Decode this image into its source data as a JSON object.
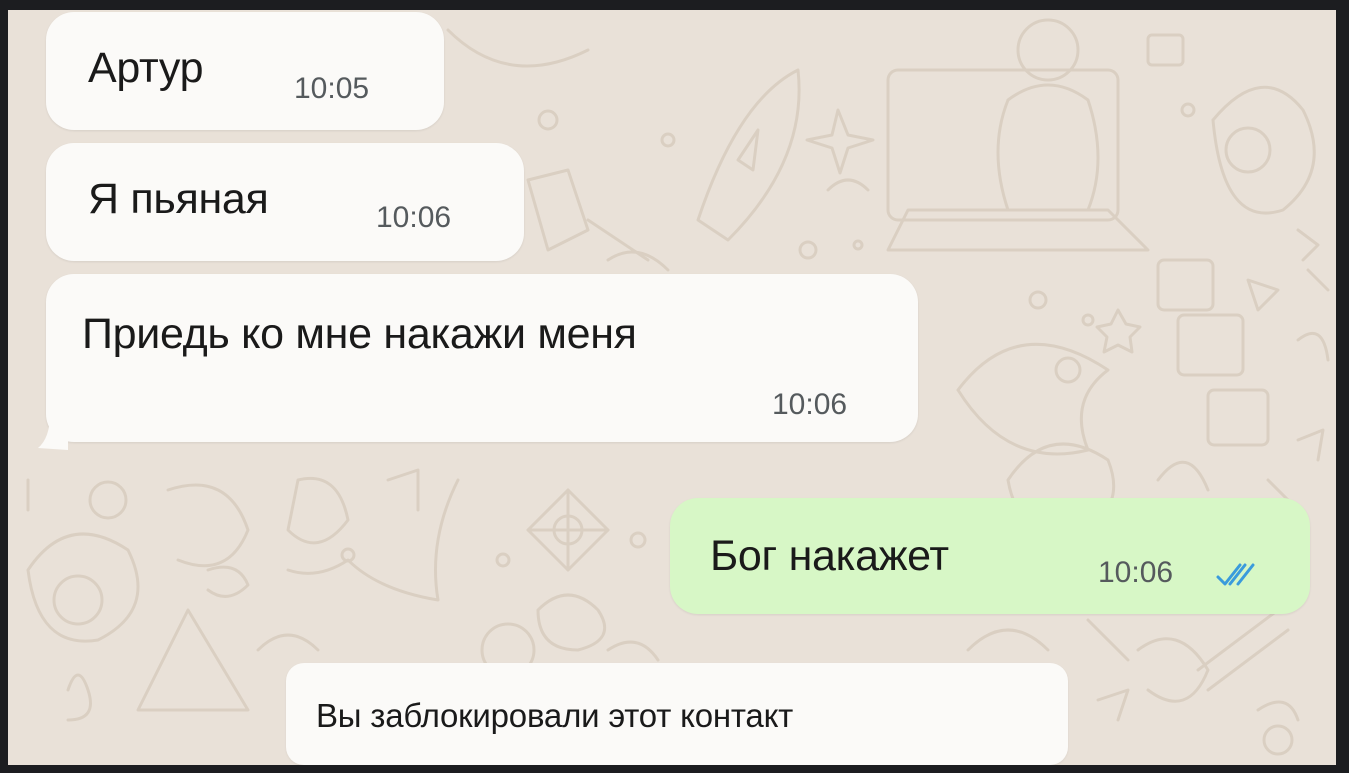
{
  "messages": [
    {
      "direction": "incoming",
      "text": "Артур",
      "time": "10:05"
    },
    {
      "direction": "incoming",
      "text": "Я пьяная",
      "time": "10:06"
    },
    {
      "direction": "incoming",
      "text": "Приедь  ко мне накажи меня",
      "time": "10:06"
    },
    {
      "direction": "outgoing",
      "text": "Бог накажет",
      "time": "10:06",
      "status": "read"
    }
  ],
  "system_notice": {
    "text": "Вы заблокировали этот контакт"
  },
  "icons": {
    "read_status": "double-check-icon"
  },
  "colors": {
    "wallpaper": "#e9e1d8",
    "incoming_bubble": "#fbfaf8",
    "outgoing_bubble": "#d7f7c6",
    "read_ticks": "#3a9bdc"
  }
}
